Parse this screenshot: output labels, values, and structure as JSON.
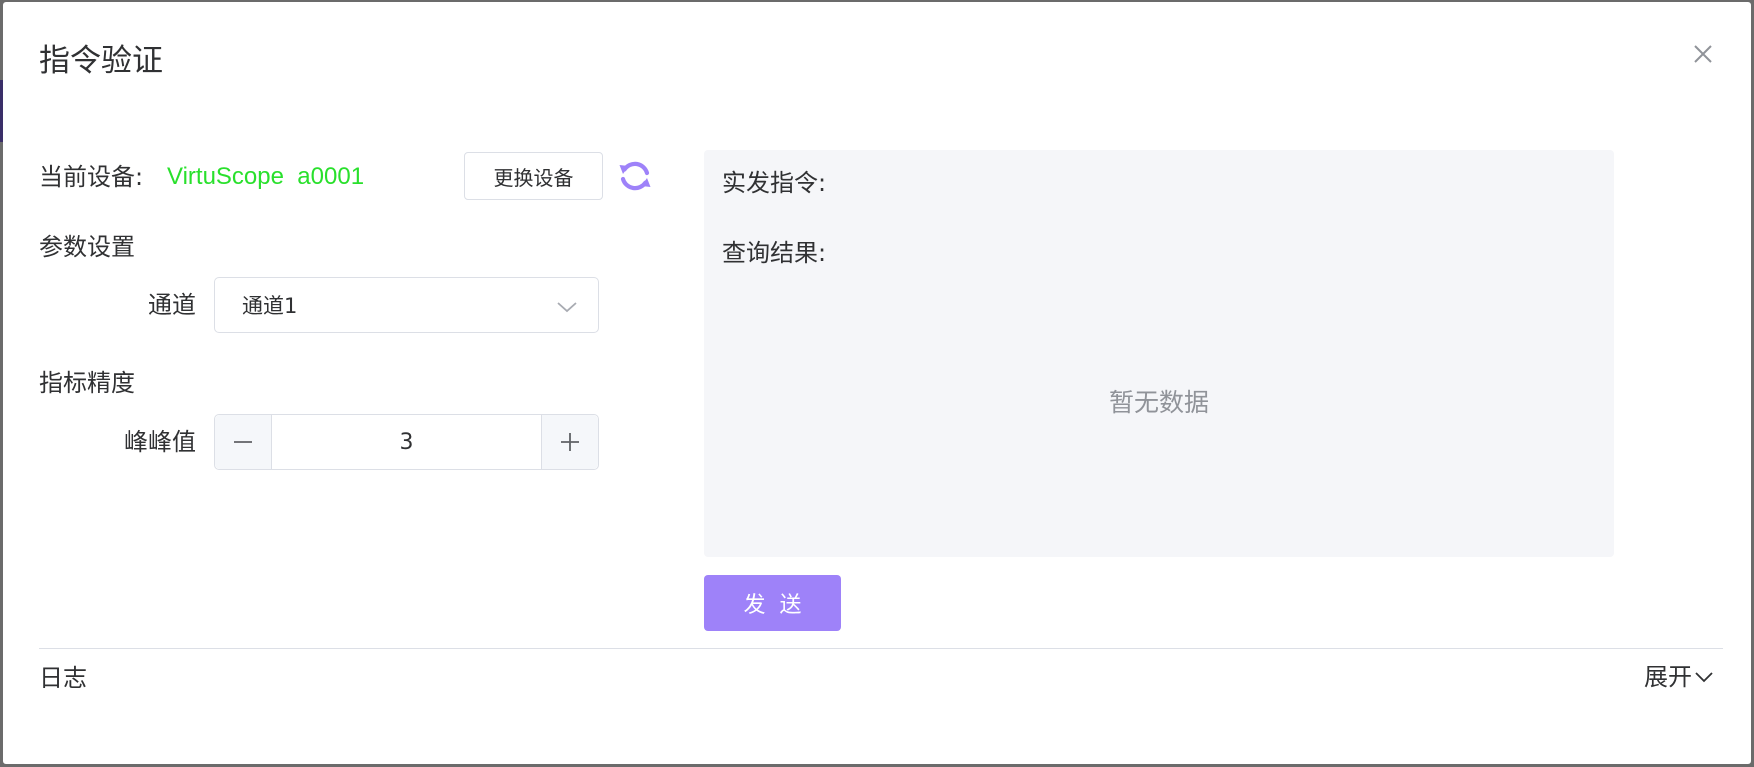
{
  "dialog": {
    "title": "指令验证"
  },
  "device": {
    "label": "当前设备:",
    "name": "VirtuScope  a0001",
    "change_button": "更换设备",
    "refresh_icon": "refresh-icon"
  },
  "params": {
    "section_title": "参数设置",
    "channel_label": "通道",
    "channel_value": "通道1"
  },
  "precision": {
    "section_title": "指标精度",
    "peak_label": "峰峰值",
    "peak_value": "3"
  },
  "result": {
    "command_label": "实发指令:",
    "query_label": "查询结果:",
    "empty_text": "暂无数据"
  },
  "actions": {
    "send_label": "发送"
  },
  "log": {
    "title": "日志",
    "expand_label": "展开"
  },
  "colors": {
    "accent": "#9e82f9",
    "device_name": "#29e02c"
  }
}
